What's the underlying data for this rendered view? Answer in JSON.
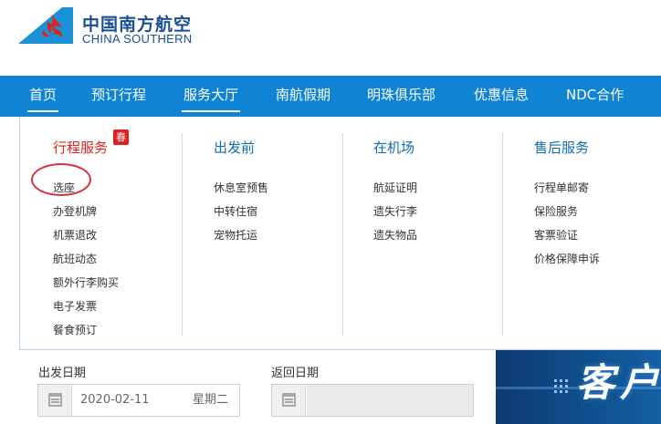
{
  "logo": {
    "name_cn": "中国南方航空",
    "name_en": "CHINA SOUTHERN",
    "brand_color": "#1b4f93"
  },
  "nav": {
    "items": [
      {
        "label": "首页",
        "active": true
      },
      {
        "label": "预订行程",
        "active": false
      },
      {
        "label": "服务大厅",
        "active": true
      },
      {
        "label": "南航假期",
        "active": false
      },
      {
        "label": "明珠俱乐部",
        "active": false
      },
      {
        "label": "优惠信息",
        "active": false
      },
      {
        "label": "NDC合作",
        "active": false
      }
    ],
    "background": "#0f83d4"
  },
  "dropdown": {
    "columns": [
      {
        "title": "行程服务",
        "badge": "春",
        "items": [
          "选座",
          "办登机牌",
          "机票退改",
          "航班动态",
          "额外行李购买",
          "电子发票",
          "餐食预订"
        ]
      },
      {
        "title": "出发前",
        "items": [
          "休息室预售",
          "中转住宿",
          "宠物托运"
        ]
      },
      {
        "title": "在机场",
        "items": [
          "航延证明",
          "遗失行李",
          "遗失物品"
        ]
      },
      {
        "title": "售后服务",
        "items": [
          "行程单邮寄",
          "保险服务",
          "客票验证",
          "价格保障申诉"
        ]
      }
    ],
    "highlight_item": "选座",
    "highlight_color": "#d9303a"
  },
  "booking": {
    "depart": {
      "label": "出发日期",
      "value": "2020-02-11",
      "weekday": "星期二"
    },
    "return": {
      "label": "返回日期",
      "value": ""
    }
  },
  "banner": {
    "text": "客户"
  }
}
